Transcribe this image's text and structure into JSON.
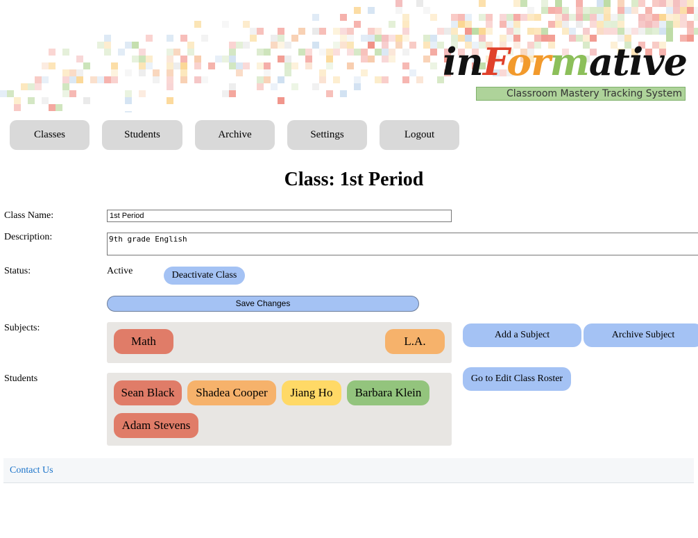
{
  "brand": {
    "logo_parts": [
      "in",
      "F",
      "or",
      "m",
      "ative"
    ],
    "tagline": "Classroom Mastery Tracking System"
  },
  "nav": {
    "items": [
      {
        "label": "Classes"
      },
      {
        "label": "Students"
      },
      {
        "label": "Archive"
      },
      {
        "label": "Settings"
      },
      {
        "label": "Logout"
      }
    ]
  },
  "main": {
    "title": "Class: 1st Period",
    "class_name": {
      "label": "Class Name:",
      "value": "1st Period"
    },
    "description": {
      "label": "Description:",
      "value": "9th grade English"
    },
    "status": {
      "label": "Status:",
      "value": "Active",
      "toggle_label": "Deactivate Class"
    },
    "save_label": "Save Changes",
    "subjects": {
      "label": "Subjects:",
      "items": [
        {
          "name": "Math",
          "color": "#e07c68"
        },
        {
          "name": "L.A.",
          "color": "#f6b26b"
        }
      ],
      "add_label": "Add a Subject",
      "archive_label": "Archive Subject"
    },
    "students": {
      "label": "Students",
      "items": [
        {
          "name": "Sean Black",
          "color": "#e07c68"
        },
        {
          "name": "Shadea Cooper",
          "color": "#f6b26b"
        },
        {
          "name": "Jiang Ho",
          "color": "#ffd966"
        },
        {
          "name": "Barbara Klein",
          "color": "#93c47d"
        },
        {
          "name": "Adam Stevens",
          "color": "#e07c68"
        }
      ],
      "roster_label": "Go to Edit Class Roster"
    }
  },
  "footer": {
    "contact_label": "Contact Us"
  }
}
